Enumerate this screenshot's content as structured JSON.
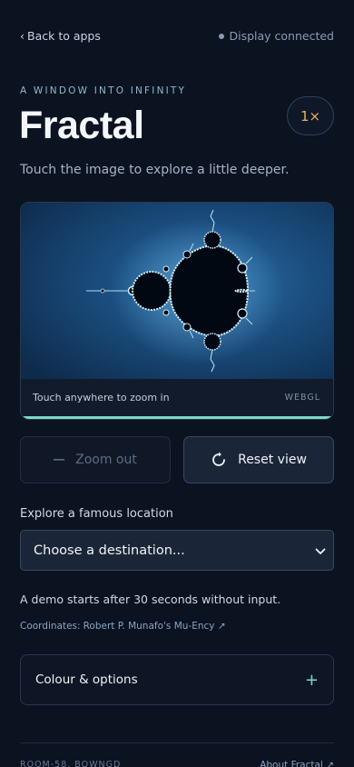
{
  "topbar": {
    "back_label": "Back to apps",
    "status_label": "Display connected"
  },
  "hero": {
    "eyebrow": "A WINDOW INTO INFINITY",
    "title": "Fractal",
    "zoom_level": "1×",
    "subtitle": "Touch the image to explore a little deeper."
  },
  "viewer": {
    "hint": "Touch anywhere to zoom in",
    "engine": "WEBGL",
    "progress": 1.0
  },
  "controls": {
    "zoom_out_label": "Zoom out",
    "reset_label": "Reset view"
  },
  "location": {
    "label": "Explore a famous location",
    "selected": "Choose a destination..."
  },
  "info": {
    "demo_note": "A demo starts after 30 seconds without input.",
    "credits_prefix": "Coordinates:",
    "credits_link": "Robert P. Munafo's Mu-Ency ↗"
  },
  "options": {
    "label": "Colour & options"
  },
  "footer": {
    "left": "ROOM-58, BOWNGD",
    "right": "About Fractal ↗"
  },
  "colors": {
    "background": "#0b1220",
    "accent": "#7fd8c8",
    "zoom_badge": "#e8b25a"
  }
}
